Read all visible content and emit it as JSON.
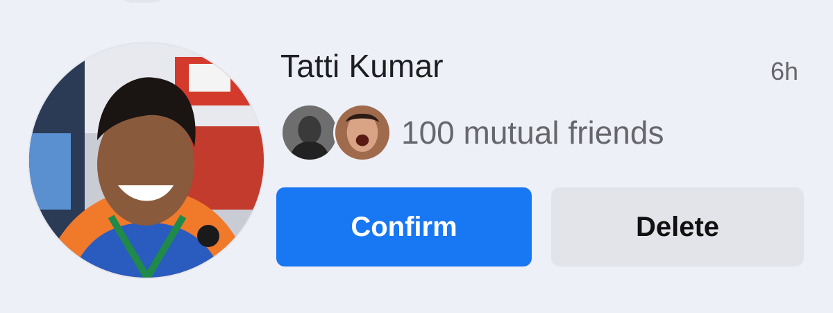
{
  "request": {
    "name": "Tatti Kumar",
    "time": "6h",
    "mutual_friends": "100 mutual friends",
    "confirm_label": "Confirm",
    "delete_label": "Delete"
  },
  "colors": {
    "confirm_bg": "#1877f2",
    "delete_bg": "#e2e4ea",
    "background": "#eef0f7"
  }
}
